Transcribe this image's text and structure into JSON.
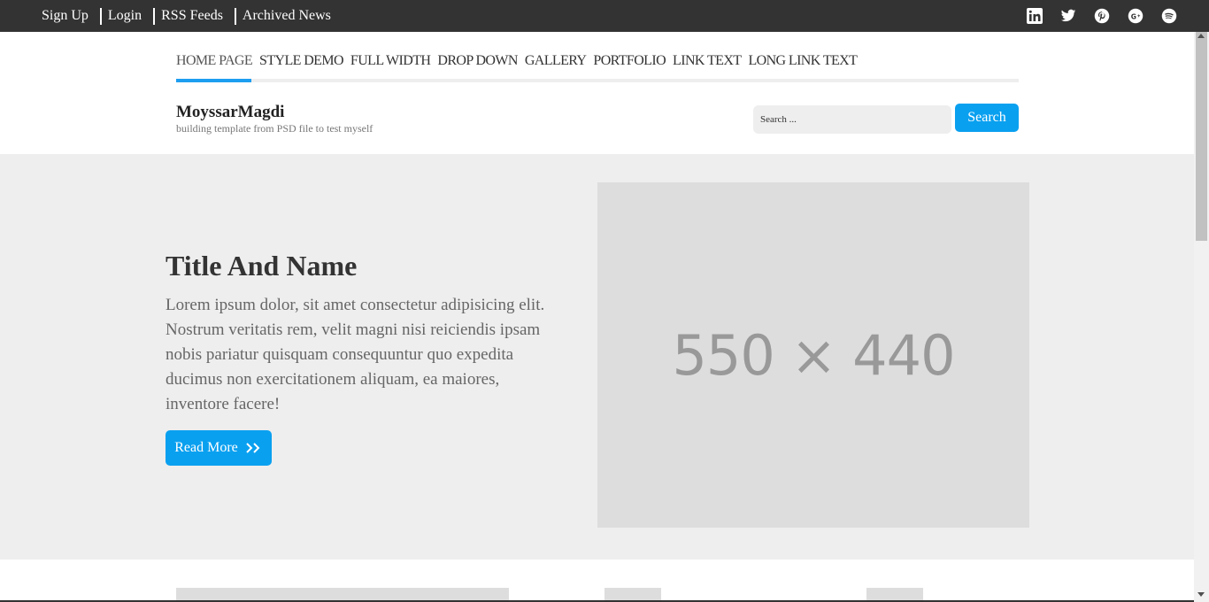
{
  "topbar": {
    "links": [
      "Sign Up",
      "Login",
      "RSS Feeds",
      "Archived News"
    ],
    "social_icons": [
      "linkedin-icon",
      "twitter-icon",
      "pinterest-icon",
      "google-plus-icon",
      "spotify-icon"
    ]
  },
  "nav": {
    "items": [
      "HOME PAGE",
      "STYLE DEMO",
      "FULL WIDTH",
      "DROP DOWN",
      "GALLERY",
      "PORTFOLIO",
      "LINK TEXT",
      "LONG LINK TEXT"
    ],
    "active_index": 0
  },
  "brand": {
    "name": "MoyssarMagdi",
    "tagline": "building template from PSD file to test myself"
  },
  "search": {
    "placeholder": "Search ...",
    "button_label": "Search"
  },
  "hero": {
    "title": "Title And Name",
    "text": "Lorem ipsum dolor, sit amet consectetur adipisicing elit. Nostrum veritatis rem, velit magni nisi reiciendis ipsam nobis pariatur quisquam consequuntur quo expedita ducimus non exercitationem aliquam, ea maiores, inventore facere!",
    "button_label": "Read More",
    "image_placeholder": "550 × 440"
  },
  "colors": {
    "topbar_bg": "#333333",
    "accent": "#0aa0f0",
    "hero_bg": "#eeeeee",
    "placeholder_bg": "#dddddd"
  }
}
